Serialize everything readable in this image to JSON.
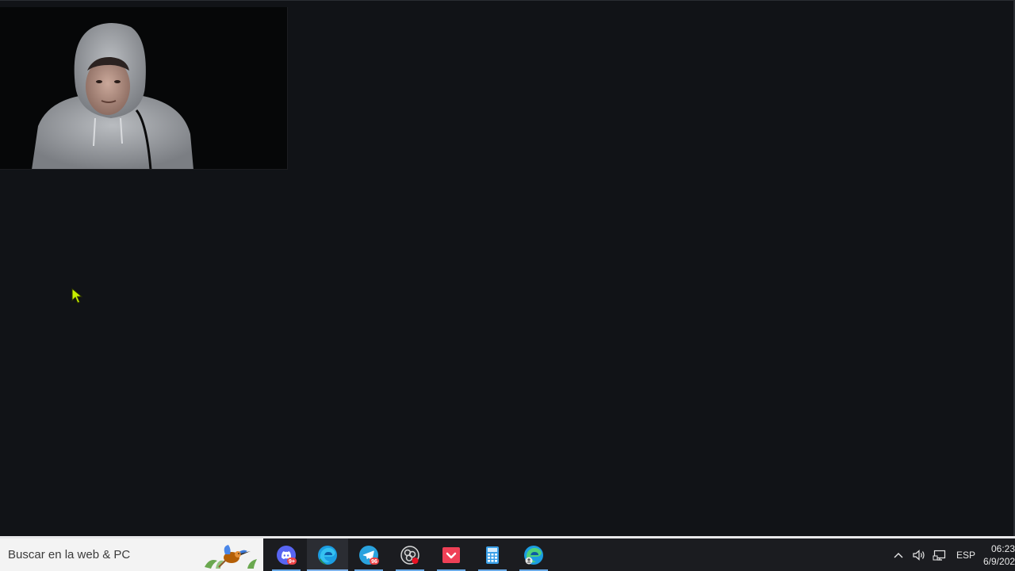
{
  "taskbar": {
    "search_placeholder": "Buscar en la web & PC",
    "apps": [
      {
        "name": "discord",
        "badge": "9+"
      },
      {
        "name": "edge"
      },
      {
        "name": "telegram",
        "badge": "96"
      },
      {
        "name": "obs-studio"
      },
      {
        "name": "pocket"
      },
      {
        "name": "calculator"
      },
      {
        "name": "edge-profile"
      }
    ],
    "language": "ESP",
    "time": "06:23",
    "date": "6/9/202"
  },
  "colors": {
    "desktop_bg": "#111317",
    "taskbar_bg": "#1b1c20",
    "search_bg": "#f3f3f3",
    "discord": "#5865f2",
    "telegram": "#2aa3de",
    "pocket": "#ef4056",
    "calculator": "#3aa0e8"
  }
}
